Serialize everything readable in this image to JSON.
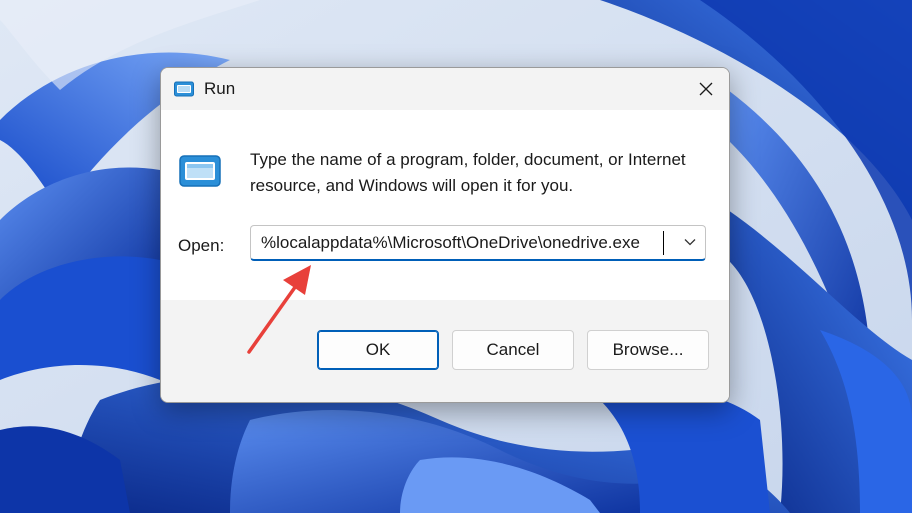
{
  "dialog": {
    "title": "Run",
    "close_icon": "close-icon",
    "description": "Type the name of a program, folder, document, or Internet resource, and Windows will open it for you.",
    "open_label": "Open:",
    "open_value": "%localappdata%\\Microsoft\\OneDrive\\onedrive.exe",
    "dropdown_icon": "chevron-down-icon",
    "buttons": {
      "ok": "OK",
      "cancel": "Cancel",
      "browse": "Browse..."
    }
  },
  "colors": {
    "accent": "#005fb8",
    "annotation_arrow": "#e8403a",
    "wallpaper_blue": "#1e5fd6"
  }
}
